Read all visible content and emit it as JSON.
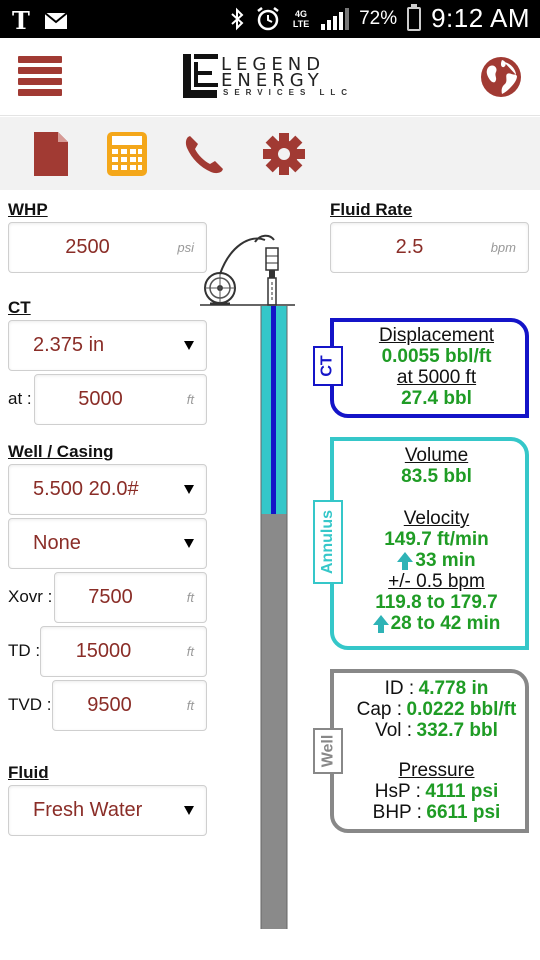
{
  "status_bar": {
    "carrier": "T",
    "network": "4G LTE",
    "battery": "72%",
    "time": "9:12 AM"
  },
  "header": {
    "logo_line1": "LEGEND",
    "logo_line2": "ENERGY",
    "logo_line3": "SERVICES LLC"
  },
  "toolbar": {
    "icons": [
      "document-icon",
      "calculator-icon",
      "phone-icon",
      "gear-icon"
    ]
  },
  "colors": {
    "brand": "#a13a33",
    "value_text": "#8a2d27",
    "green": "#1f9c25",
    "ct_blue": "#1414c8",
    "annulus_teal": "#35c7c9",
    "well_gray": "#888888"
  },
  "inputs": {
    "whp": {
      "label": "WHP",
      "value": "2500",
      "unit": "psi"
    },
    "fluid_rate": {
      "label": "Fluid Rate",
      "value": "2.5",
      "unit": "bpm"
    },
    "ct": {
      "label": "CT",
      "selected": "2.375 in"
    },
    "ct_at": {
      "label": "at :",
      "value": "5000",
      "unit": "ft"
    },
    "well_casing": {
      "label": "Well / Casing",
      "selected": "5.500 20.0#",
      "second_selected": "None"
    },
    "xovr": {
      "label": "Xovr :",
      "value": "7500",
      "unit": "ft"
    },
    "td": {
      "label": "TD :",
      "value": "15000",
      "unit": "ft"
    },
    "tvd": {
      "label": "TVD :",
      "value": "9500",
      "unit": "ft"
    },
    "fluid": {
      "label": "Fluid",
      "selected": "Fresh Water"
    }
  },
  "ct_box": {
    "tag": "CT",
    "title": "Displacement",
    "displacement": "0.0055 bbl/ft",
    "at": "at 5000 ft",
    "volume": "27.4 bbl"
  },
  "annulus_box": {
    "tag": "Annulus",
    "volume_title": "Volume",
    "volume": "83.5 bbl",
    "velocity_title": "Velocity",
    "velocity": "149.7 ft/min",
    "up_time": "33 min",
    "range_title": "+/- 0.5 bpm",
    "velocity_range": "119.8 to 179.7",
    "time_range": "28 to 42 min"
  },
  "well_box": {
    "tag": "Well",
    "id_label": "ID :",
    "id_value": "4.778 in",
    "cap_label": "Cap :",
    "cap_value": "0.0222 bbl/ft",
    "vol_label": "Vol :",
    "vol_value": "332.7 bbl",
    "pressure_title": "Pressure",
    "hsp_label": "HsP :",
    "hsp_value": "4111 psi",
    "bhp_label": "BHP :",
    "bhp_value": "6611 psi"
  }
}
